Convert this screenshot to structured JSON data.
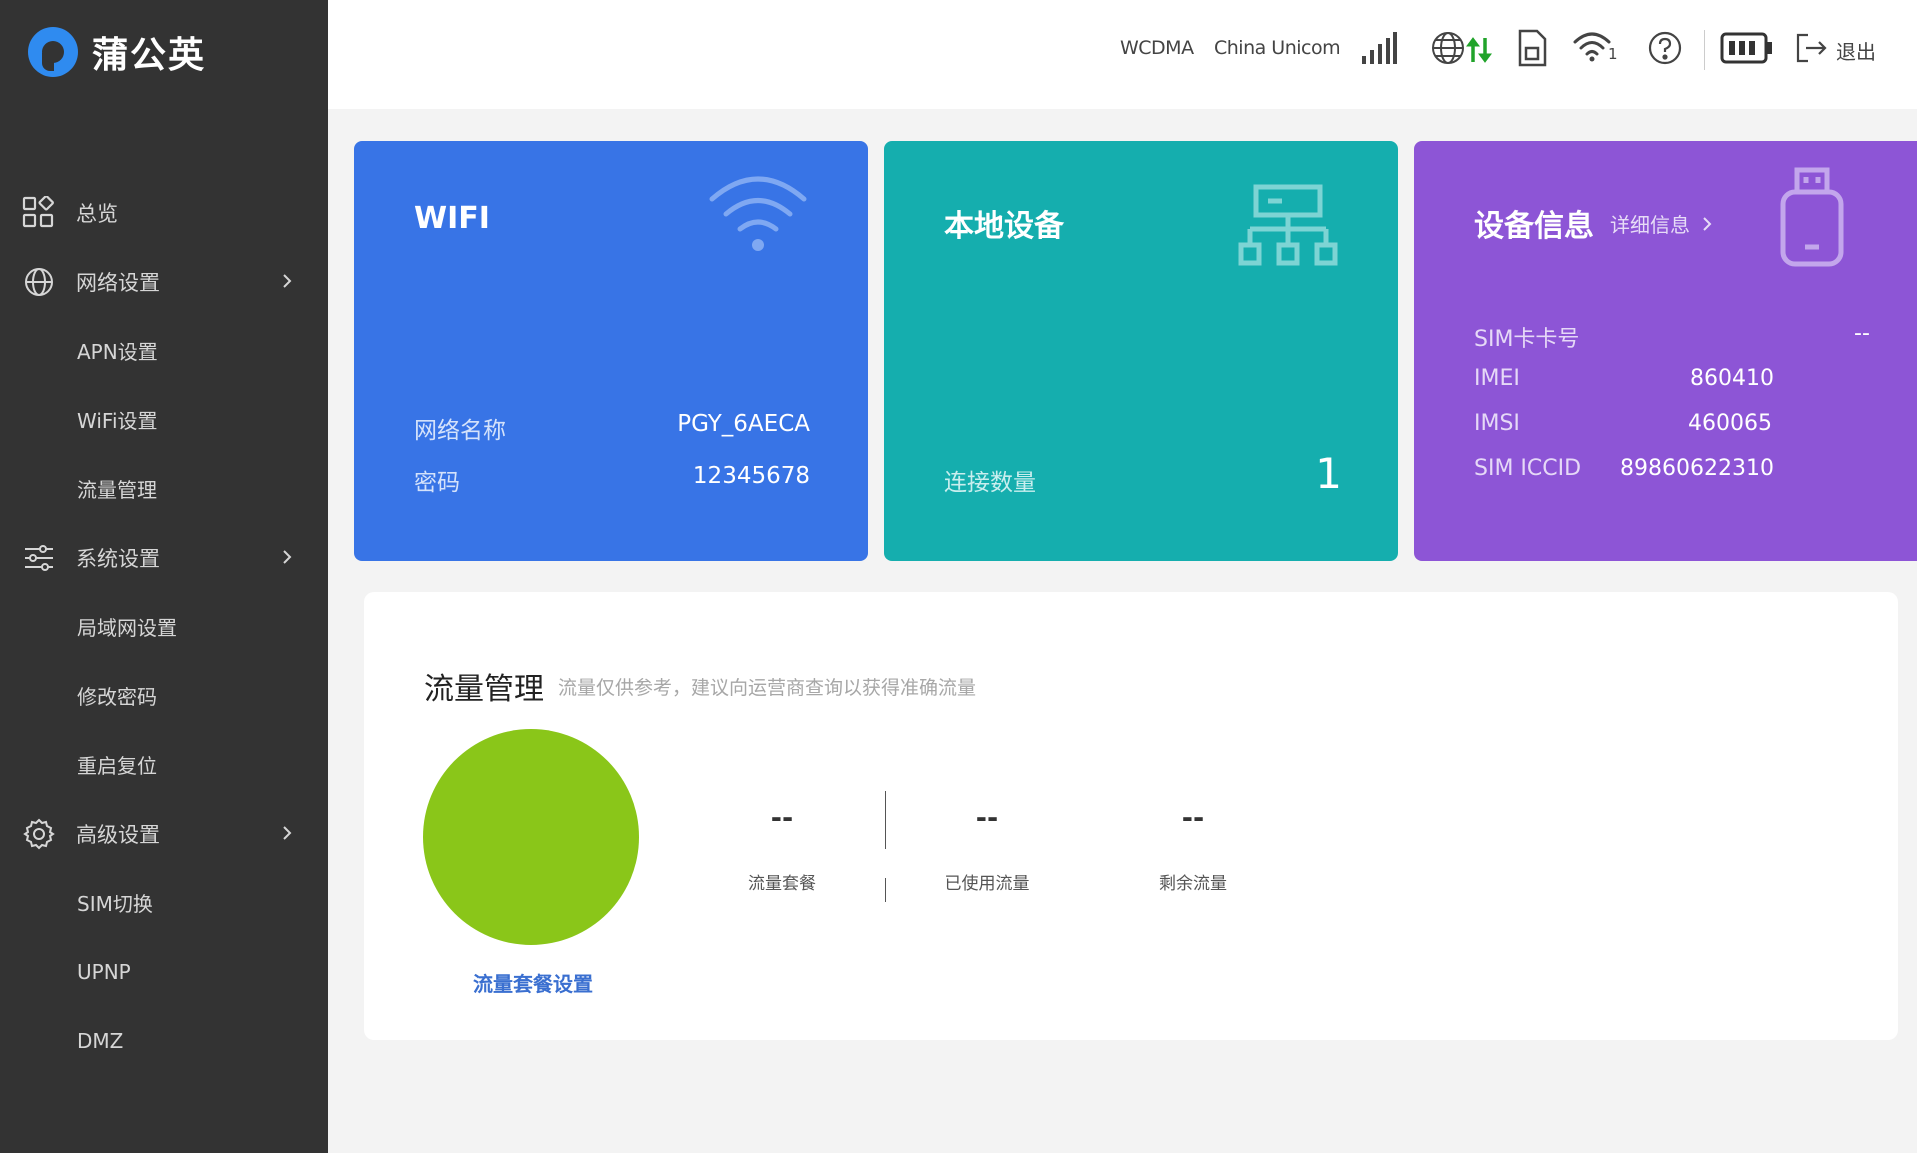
{
  "brand": {
    "name": "蒲公英",
    "logo_color": "#2f8bf0"
  },
  "sidebar": {
    "items": [
      {
        "label": "总览",
        "icon": "grid-icon",
        "level": "top"
      },
      {
        "label": "网络设置",
        "icon": "globe-icon",
        "level": "top",
        "expandable": true
      },
      {
        "label": "APN设置",
        "level": "sub"
      },
      {
        "label": "WiFi设置",
        "level": "sub"
      },
      {
        "label": "流量管理",
        "level": "sub"
      },
      {
        "label": "系统设置",
        "icon": "sliders-icon",
        "level": "top",
        "expandable": true
      },
      {
        "label": "局域网设置",
        "level": "sub"
      },
      {
        "label": "修改密码",
        "level": "sub"
      },
      {
        "label": "重启复位",
        "level": "sub"
      },
      {
        "label": "高级设置",
        "icon": "gear-icon",
        "level": "top",
        "expandable": true
      },
      {
        "label": "SIM切换",
        "level": "sub"
      },
      {
        "label": "UPNP",
        "level": "sub"
      },
      {
        "label": "DMZ",
        "level": "sub"
      }
    ]
  },
  "header": {
    "network_type": "WCDMA",
    "carrier": "China Unicom",
    "wifi_clients": "1",
    "logout_label": "退出",
    "icons": [
      "signal-icon",
      "globe-data-icon",
      "sim-card-icon",
      "wifi-icon",
      "help-icon",
      "battery-icon",
      "logout-icon"
    ],
    "accent_up_down": "#21a32a"
  },
  "cards": {
    "wifi": {
      "title": "WIFI",
      "color": "#3874e6",
      "rows": [
        {
          "label": "网络名称",
          "value": "PGY_6AECA"
        },
        {
          "label": "密码",
          "value": "12345678"
        }
      ]
    },
    "local": {
      "title": "本地设备",
      "color": "#15aeae",
      "rows": [
        {
          "label": "连接数量",
          "value": "1"
        }
      ]
    },
    "device": {
      "title": "设备信息",
      "link": "详细信息",
      "color": "#8d55d6",
      "rows": [
        {
          "label": "SIM卡卡号",
          "value": "--"
        },
        {
          "label": "IMEI",
          "value": "860410"
        },
        {
          "label": "IMSI",
          "value": "460065"
        },
        {
          "label": "SIM ICCID",
          "value": "89860622310"
        }
      ]
    }
  },
  "traffic": {
    "title": "流量管理",
    "note": "流量仅供参考，建议向运营商查询以获得准确流量",
    "ring_color": "#8ac619",
    "plan_link": "流量套餐设置",
    "stats": [
      {
        "value": "--",
        "label": "流量套餐"
      },
      {
        "value": "--",
        "label": "已使用流量"
      },
      {
        "value": "--",
        "label": "剩余流量"
      }
    ]
  }
}
